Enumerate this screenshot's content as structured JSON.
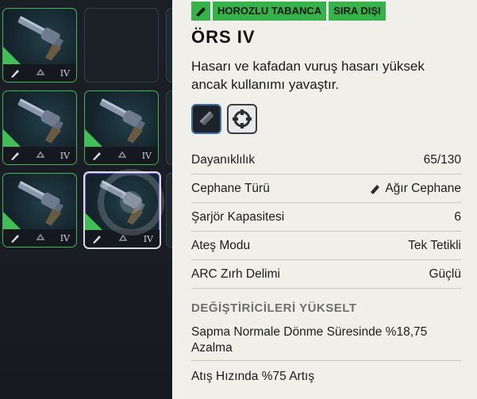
{
  "grid": {
    "slots": [
      {
        "tier": "IV"
      },
      {
        "tier": ""
      },
      {
        "tier": "IV"
      },
      {
        "tier": "IV"
      },
      {
        "tier": "IV"
      },
      {
        "tier": "IV"
      }
    ]
  },
  "item": {
    "tags": [
      "HOROZLU TABANCA",
      "SIRA DIŞI"
    ],
    "name": "ÖRS IV",
    "description": "Hasarı ve kafadan vuruş hasarı yüksek ancak kullanımı yavaştır.",
    "stats": [
      {
        "label": "Dayanıklılık",
        "value": "65/130"
      },
      {
        "label": "Cephane Türü",
        "value": "Ağır Cephane"
      },
      {
        "label": "Şarjör Kapasitesi",
        "value": "6"
      },
      {
        "label": "Ateş Modu",
        "value": "Tek Tetikli"
      },
      {
        "label": "ARC Zırh Delimi",
        "value": "Güçlü"
      }
    ],
    "upgrades_title": "DEĞİŞTİRİCİLERİ YÜKSELT",
    "upgrades": [
      "Sapma Normale Dönme Süresinde %18,75 Azalma",
      "Atış Hızında %75 Artış"
    ]
  },
  "colors": {
    "rarity": "#35b34a",
    "panel_bg": "#f1efe9",
    "grid_bg": "#1a1e25"
  }
}
